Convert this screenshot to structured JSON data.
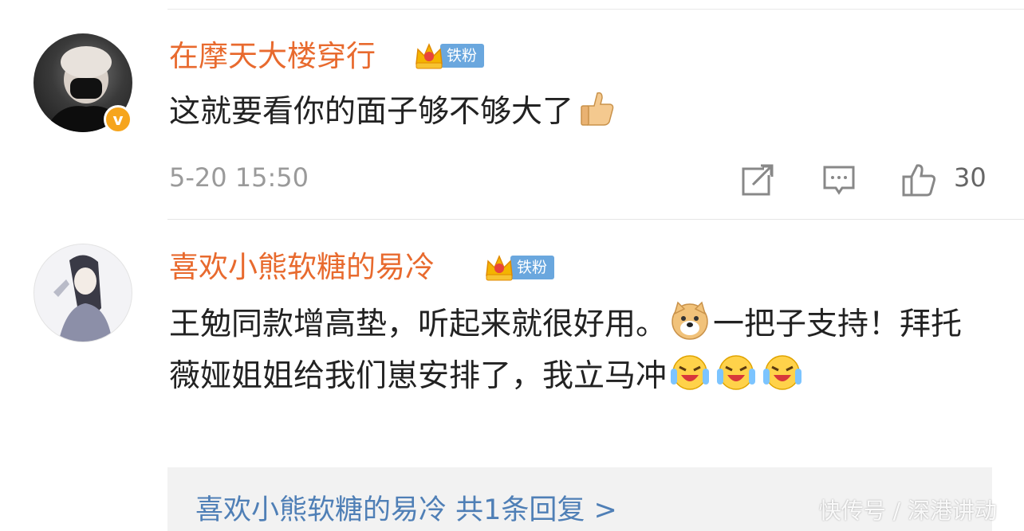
{
  "comments": [
    {
      "username": "在摩天大楼穿行",
      "fan_badge": "铁粉",
      "verified": true,
      "text": "这就要看你的面子够不够大了",
      "emoji": "thumbs-up",
      "time": "5-20 15:50",
      "likes": "30"
    },
    {
      "username": "喜欢小熊软糖的易冷",
      "fan_badge": "铁粉",
      "text_part1": "王勉同款增高垫，听起来就很好用。",
      "text_part2": "一把子支持！拜托薇娅姐姐给我们崽安排了，我立马冲",
      "reply_link": "喜欢小熊软糖的易冷 共1条回复 >"
    }
  ],
  "watermark": "快传号 / 深港讲动",
  "colors": {
    "username": "#e86a2e",
    "fan_badge": "#6aa7de",
    "reply_link": "#4f7fb6",
    "verified_badge": "#f6a51d"
  }
}
